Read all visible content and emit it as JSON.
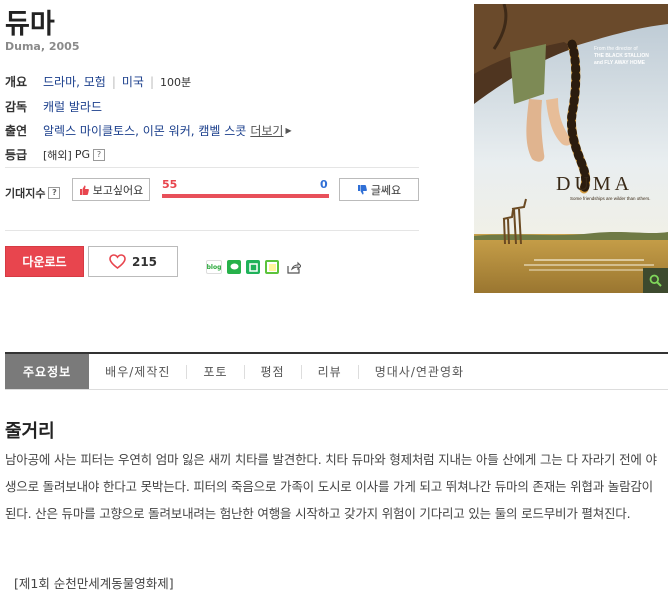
{
  "movie": {
    "title": "듀마",
    "subtitle": "Duma, 2005",
    "overview_label": "개요",
    "genres": "드라마, 모험",
    "country": "미국",
    "runtime": "100분",
    "director_label": "감독",
    "director": "캐럴 발라드",
    "cast_label": "출연",
    "cast": "알렉스 마이클토스, 이몬 워커, 캠벨 스콧",
    "more_label": "더보기",
    "rating_label": "등급",
    "rating_region": "[해외]",
    "rating": "PG"
  },
  "anticipation": {
    "label": "기대지수",
    "like_label": "보고싶어요",
    "dislike_label": "글쎄요",
    "like_count": "55",
    "dislike_count": "0",
    "like_fraction": 1.0
  },
  "actions": {
    "download_label": "다운로드",
    "heart_count": "215"
  },
  "share_icons": [
    "blog-icon",
    "talk-icon",
    "band-icon",
    "line-icon",
    "share-icon"
  ],
  "poster": {
    "tagline_top": "From the director of THE BLACK STALLION and FLY AWAY HOME",
    "title": "DUMA",
    "tagline": "Some friendships are wilder than others."
  },
  "tabs": [
    {
      "label": "주요정보",
      "active": true
    },
    {
      "label": "배우/제작진",
      "active": false
    },
    {
      "label": "포토",
      "active": false
    },
    {
      "label": "평점",
      "active": false
    },
    {
      "label": "리뷰",
      "active": false
    },
    {
      "label": "명대사/연관영화",
      "active": false
    }
  ],
  "synopsis": {
    "title": "줄거리",
    "body": "남아공에 사는 피터는 우연히 엄마 잃은 새끼 치타를 발견한다. 치타 듀마와 형제처럼 지내는 아들 산에게 그는 다 자라기 전에 야생으로 돌려보내야 한다고 못박는다. 피터의 죽음으로 가족이 도시로 이사를 가게 되고 뛰쳐나간 듀마의 존재는 위협과 놀람감이 된다. 산은 듀마를 고향으로 돌려보내려는 험난한 여행을 시작하고 갖가지 위험이 기다리고 있는 둘의 로드무비가 펼쳐진다.",
    "festival": "[제1회 순천만세계동물영화제]"
  },
  "colors": {
    "accent_red": "#e8454e",
    "link_blue": "#1b3f8c",
    "dislike_blue": "#2f6fd6"
  }
}
